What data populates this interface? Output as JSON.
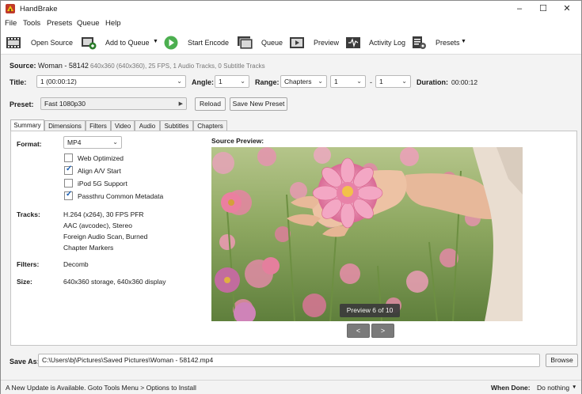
{
  "window": {
    "title": "HandBrake"
  },
  "menu": [
    "File",
    "Tools",
    "Presets",
    "Queue",
    "Help"
  ],
  "toolbar": {
    "open_source": "Open Source",
    "add_to_queue": "Add to Queue",
    "start_encode": "Start Encode",
    "queue": "Queue",
    "preview": "Preview",
    "activity_log": "Activity Log",
    "presets": "Presets"
  },
  "source": {
    "label": "Source:",
    "name": "Woman - 58142",
    "details": "640x360 (640x360), 25 FPS, 1 Audio Tracks, 0 Subtitle Tracks"
  },
  "title_row": {
    "title_label": "Title:",
    "title_value": "1 (00:00:12)",
    "angle_label": "Angle:",
    "angle_value": "1",
    "range_label": "Range:",
    "range_value": "Chapters",
    "range_start": "1",
    "range_sep": "-",
    "range_end": "1",
    "duration_label": "Duration:",
    "duration_value": "00:00:12"
  },
  "preset": {
    "label": "Preset:",
    "value": "Fast 1080p30",
    "reload": "Reload",
    "save_new": "Save New Preset"
  },
  "tabs": [
    "Summary",
    "Dimensions",
    "Filters",
    "Video",
    "Audio",
    "Subtitles",
    "Chapters"
  ],
  "summary": {
    "format_label": "Format:",
    "format_value": "MP4",
    "options": [
      {
        "label": "Web Optimized",
        "checked": false
      },
      {
        "label": "Align A/V Start",
        "checked": true
      },
      {
        "label": "iPod 5G Support",
        "checked": false
      },
      {
        "label": "Passthru Common Metadata",
        "checked": true
      }
    ],
    "tracks_label": "Tracks:",
    "tracks": [
      "H.264 (x264), 30 FPS PFR",
      "AAC (avcodec), Stereo",
      "Foreign Audio Scan, Burned",
      "Chapter Markers"
    ],
    "filters_label": "Filters:",
    "filters_value": "Decomb",
    "size_label": "Size:",
    "size_value": "640x360 storage, 640x360 display"
  },
  "source_preview": {
    "label": "Source Preview:",
    "badge": "Preview 6 of 10",
    "prev": "<",
    "next": ">"
  },
  "save_as": {
    "label": "Save As:",
    "path": "C:\\Users\\bj\\Pictures\\Saved Pictures\\Woman - 58142.mp4",
    "browse": "Browse"
  },
  "status": {
    "message": "A New Update is Available. Goto Tools Menu > Options to Install",
    "when_done_label": "When Done:",
    "when_done_value": "Do nothing"
  }
}
